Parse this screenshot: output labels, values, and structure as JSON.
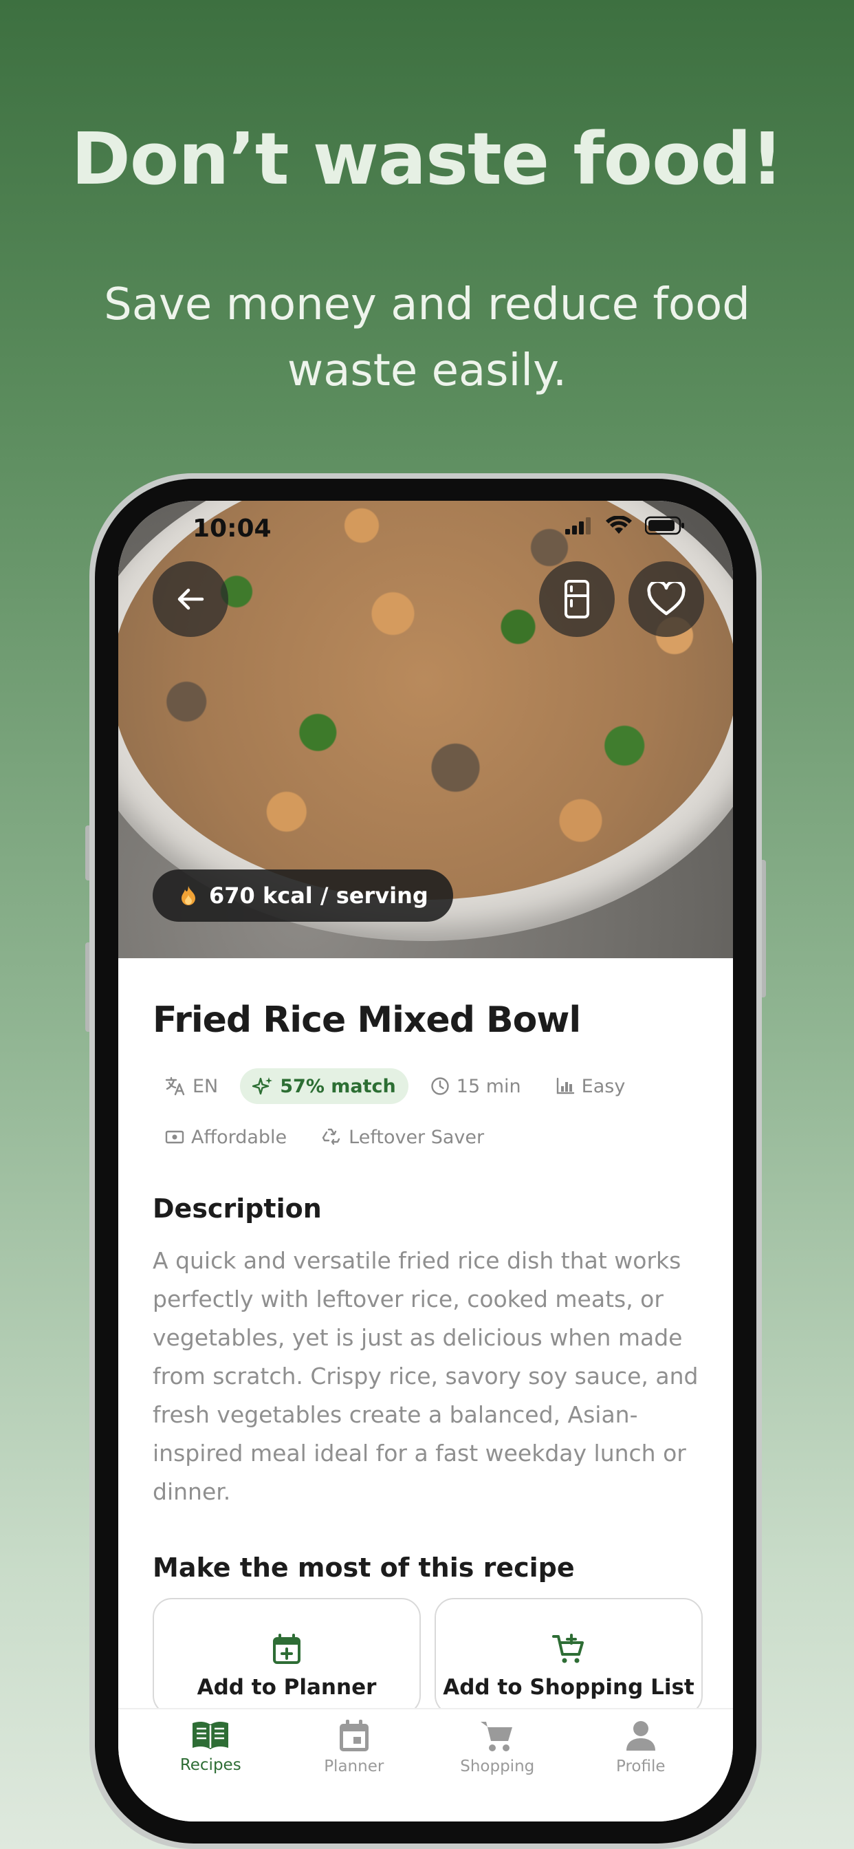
{
  "promo": {
    "headline": "Don’t waste food!",
    "subline": "Save money and reduce food waste easily."
  },
  "status_bar": {
    "time": "10:04"
  },
  "recipe": {
    "kcal": "670 kcal / serving",
    "title": "Fried Rice Mixed Bowl",
    "tags": {
      "language": "EN",
      "match": "57% match",
      "time": "15 min",
      "difficulty": "Easy",
      "price": "Affordable",
      "leftover": "Leftover Saver"
    },
    "description_heading": "Description",
    "description": "A quick and versatile fried rice dish that works perfectly with leftover rice, cooked meats, or vegetables, yet is just as delicious when made from scratch. Crispy rice, savory soy sauce, and fresh vegetables create a balanced, Asian-inspired meal ideal for a fast weekday lunch or dinner.",
    "actions_heading": "Make the most of this recipe",
    "actions": {
      "planner": "Add to Planner",
      "shopping": "Add to Shopping List"
    }
  },
  "tabbar": {
    "recipes": "Recipes",
    "planner": "Planner",
    "shopping": "Shopping",
    "profile": "Profile"
  },
  "colors": {
    "brand_green": "#2e6d35",
    "match_bg": "#e4f1e3",
    "flame": "#f0a236"
  },
  "icons": [
    "back-arrow-icon",
    "fridge-icon",
    "heart-icon",
    "flame-icon",
    "translate-icon",
    "sparkle-icon",
    "clock-icon",
    "bar-chart-icon",
    "money-icon",
    "recycle-icon",
    "calendar-plus-icon",
    "cart-plus-icon",
    "book-icon",
    "calendar-icon",
    "cart-icon",
    "person-icon"
  ]
}
